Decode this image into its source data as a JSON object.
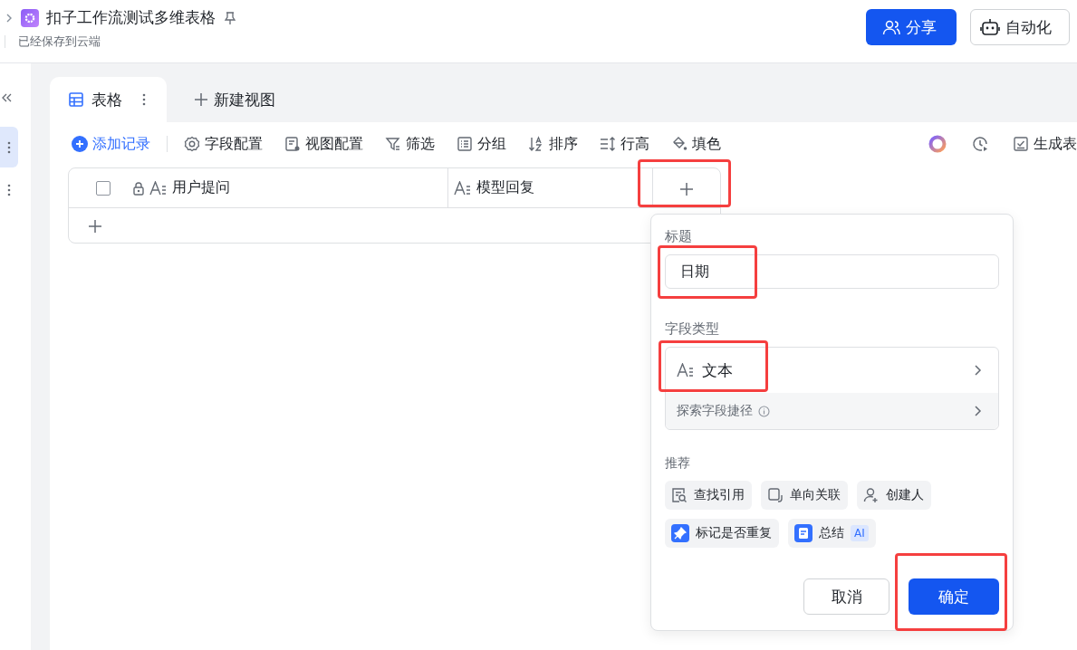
{
  "header": {
    "title": "扣子工作流测试多维表格",
    "save_status": "已经保存到云端",
    "buttons": [
      {
        "kind": "share",
        "label": "分享",
        "primary": true
      },
      {
        "kind": "automation",
        "label": "自动化",
        "primary": false
      }
    ]
  },
  "sidebar": {
    "items": [
      {
        "selected": true
      },
      {
        "selected": false
      }
    ]
  },
  "views": {
    "tabs": [
      {
        "label": "表格",
        "selected": true
      }
    ],
    "new_view": "新建视图"
  },
  "toolbar": {
    "items": [
      {
        "kind": "add",
        "label": "添加记录"
      },
      {
        "kind": "fields",
        "label": "字段配置"
      },
      {
        "kind": "view",
        "label": "视图配置"
      },
      {
        "kind": "filter",
        "label": "筛选"
      },
      {
        "kind": "group",
        "label": "分组"
      },
      {
        "kind": "sort",
        "label": "排序"
      },
      {
        "kind": "rowheight",
        "label": "行高"
      },
      {
        "kind": "fill",
        "label": "填色"
      }
    ],
    "right": [
      {
        "kind": "ai"
      },
      {
        "kind": "history"
      },
      {
        "kind": "form",
        "label": "生成表"
      }
    ]
  },
  "table": {
    "select_all": {
      "checked": false
    },
    "columns": [
      {
        "label": "用户提问",
        "locked": true
      },
      {
        "label": "模型回复",
        "locked": false
      }
    ],
    "add_column": {
      "highlighted": true
    }
  },
  "field_popup": {
    "title_label": "标题",
    "title_value": "日期",
    "title_highlighted": true,
    "type_label": "字段类型",
    "type_value": "文本",
    "type_highlighted": true,
    "shortcut": "探索字段捷径",
    "recommend_label": "推荐",
    "recommendations": [
      {
        "kind": "lookup",
        "label": "查找引用"
      },
      {
        "kind": "link",
        "label": "单向关联"
      },
      {
        "kind": "creator",
        "label": "创建人"
      },
      {
        "kind": "duplicate",
        "label": "标记是否重复"
      },
      {
        "kind": "summary",
        "label": "总结",
        "badge": "AI"
      }
    ],
    "cancel": "取消",
    "confirm": "确定",
    "confirm_highlighted": true
  }
}
